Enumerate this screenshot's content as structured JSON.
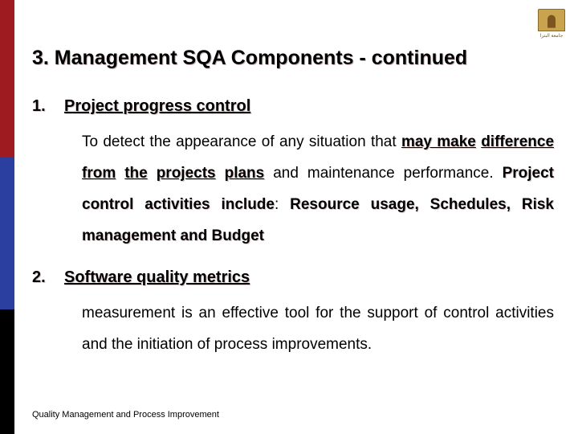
{
  "logo": {
    "caption": "جامعة البترا"
  },
  "title": "3. Management SQA Components - continued",
  "items": [
    {
      "num": "1.",
      "heading": "Project progress control",
      "body_html": "To detect the appearance of any situation that <span class='em'>may make</span> <span class='em'>difference</span> <span class='em'>from</span> <span class='em'>the</span> <span class='em'>projects</span> <span class='em'>plans</span> and maintenance performance. <span class='em2'>Project control activities include</span>: <span class='em2'>Resource usage, Schedules, Risk management and Budget</span>"
    },
    {
      "num": "2.",
      "heading": "Software quality metrics",
      "body_html": "measurement is an effective tool for the support of control activities and the initiation of process improvements."
    }
  ],
  "footer": "Quality Management and Process Improvement"
}
